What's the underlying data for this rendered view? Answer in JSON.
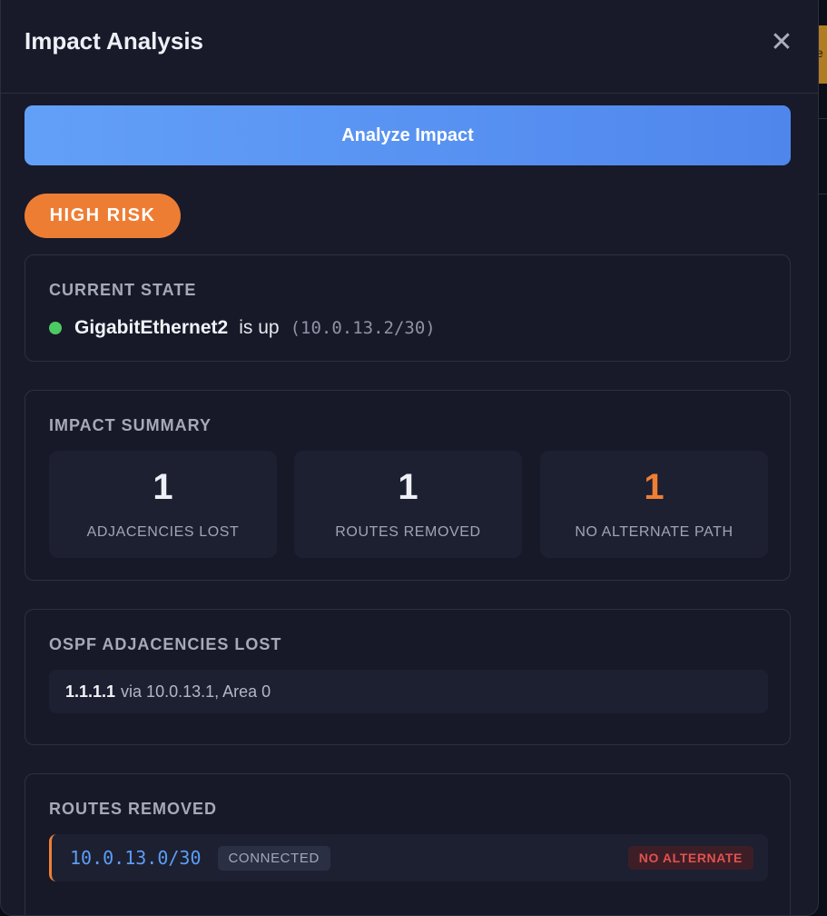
{
  "modal": {
    "title": "Impact Analysis",
    "close_icon": "✕",
    "analyze_button_label": "Analyze Impact",
    "risk_level": "HIGH RISK"
  },
  "current_state": {
    "title": "CURRENT STATE",
    "interface": "GigabitEthernet2",
    "status_text": "is up",
    "ip": "(10.0.13.2/30)",
    "status_color": "#4ccb62"
  },
  "impact_summary": {
    "title": "IMPACT SUMMARY",
    "stats": [
      {
        "value": "1",
        "label": "ADJACENCIES LOST"
      },
      {
        "value": "1",
        "label": "ROUTES REMOVED"
      },
      {
        "value": "1",
        "label": "NO ALTERNATE PATH"
      }
    ]
  },
  "adjacencies": {
    "title": "OSPF ADJACENCIES LOST",
    "items": [
      {
        "router_id": "1.1.1.1",
        "detail": "via 10.0.13.1, Area 0"
      }
    ]
  },
  "routes": {
    "title": "ROUTES REMOVED",
    "items": [
      {
        "prefix": "10.0.13.0/30",
        "type": "CONNECTED",
        "alternate": "NO ALTERNATE"
      }
    ]
  },
  "backdrop": {
    "peek_text": "e"
  },
  "colors": {
    "accent_blue": "#5c9df5",
    "risk_orange": "#ee7d34",
    "danger_red": "#e0524f",
    "panel_bg": "#181a2a"
  }
}
